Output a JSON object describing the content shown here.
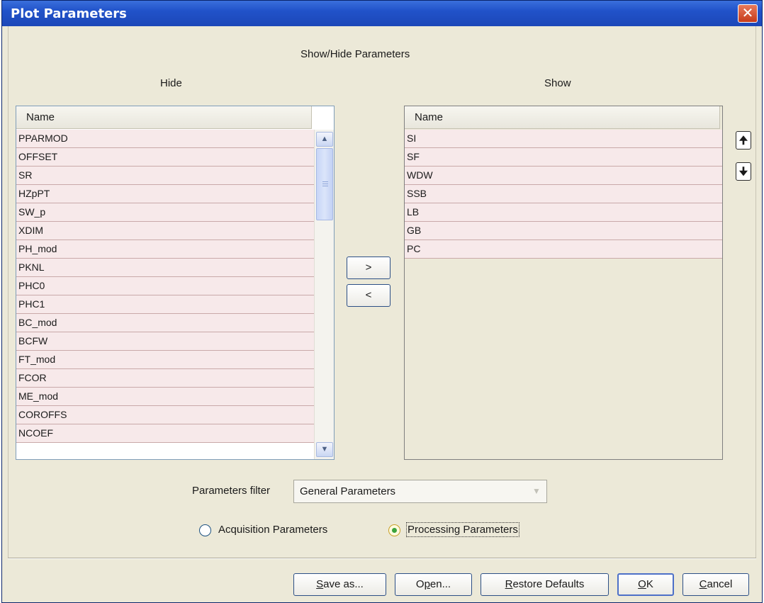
{
  "window": {
    "title": "Plot Parameters",
    "close_glyph": "✕"
  },
  "section_title": "Show/Hide Parameters",
  "hide_panel": {
    "label": "Hide",
    "column_header": "Name",
    "items": [
      "PPARMOD",
      "OFFSET",
      "SR",
      "HZpPT",
      "SW_p",
      "XDIM",
      "PH_mod",
      "PKNL",
      "PHC0",
      "PHC1",
      "BC_mod",
      "BCFW",
      "FT_mod",
      "FCOR",
      "ME_mod",
      "COROFFS",
      "NCOEF"
    ],
    "scroll_up_glyph": "▲",
    "scroll_down_glyph": "▼"
  },
  "show_panel": {
    "label": "Show",
    "column_header": "Name",
    "items": [
      "SI",
      "SF",
      "WDW",
      "SSB",
      "LB",
      "GB",
      "PC"
    ]
  },
  "transfer": {
    "move_right_label": ">",
    "move_left_label": "<"
  },
  "reorder": {
    "up_icon": "up-arrow-icon",
    "down_icon": "down-arrow-icon",
    "up_glyph": "🠉",
    "down_glyph": "🠋"
  },
  "filter": {
    "label": "Parameters filter",
    "selected": "General Parameters",
    "dropdown_glyph": "▼"
  },
  "radios": {
    "acquisition_label": "Acquisition Parameters",
    "processing_label": "Processing Parameters",
    "selected": "processing"
  },
  "footer": {
    "save_as": {
      "pre": "",
      "mnemonic": "S",
      "post": "ave as..."
    },
    "open": {
      "pre": "O",
      "mnemonic": "p",
      "post": "en..."
    },
    "restore": {
      "pre": "",
      "mnemonic": "R",
      "post": "estore Defaults"
    },
    "ok": {
      "pre": "",
      "mnemonic": "O",
      "post": "K"
    },
    "cancel": {
      "pre": "",
      "mnemonic": "C",
      "post": "ancel"
    }
  }
}
